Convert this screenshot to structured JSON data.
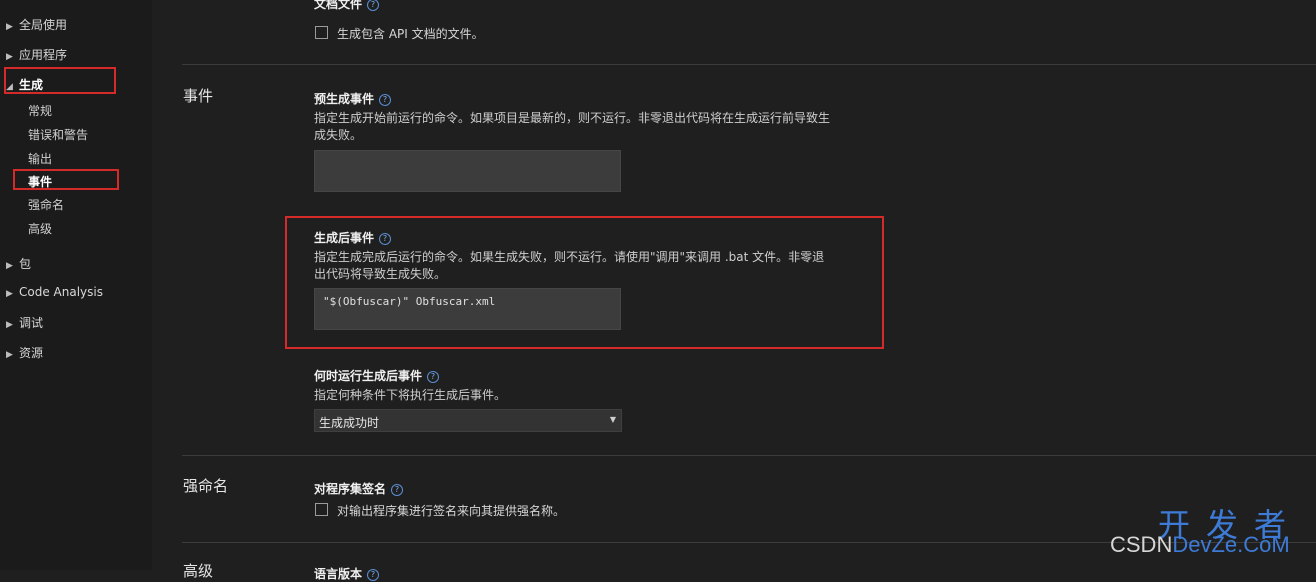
{
  "sidebar": {
    "items": [
      {
        "label": "全局使用",
        "arrow": "▶"
      },
      {
        "label": "应用程序",
        "arrow": "▶"
      },
      {
        "label": "生成",
        "arrow": "◢",
        "expanded": true
      },
      {
        "label": "包",
        "arrow": "▶"
      },
      {
        "label": "Code Analysis",
        "arrow": "▶"
      },
      {
        "label": "调试",
        "arrow": "▶"
      },
      {
        "label": "资源",
        "arrow": "▶"
      }
    ],
    "build_subitems": [
      {
        "label": "常规"
      },
      {
        "label": "错误和警告"
      },
      {
        "label": "输出"
      },
      {
        "label": "事件",
        "selected": true
      },
      {
        "label": "强命名"
      },
      {
        "label": "高级"
      }
    ]
  },
  "main": {
    "top_partial_label": "文档文件",
    "doc_checkbox_label": "生成包含 API 文档的文件。",
    "events_section": {
      "title": "事件",
      "pre_build": {
        "title": "预生成事件",
        "desc": "指定生成开始前运行的命令。如果项目是最新的，则不运行。非零退出代码将在生成运行前导致生成失败。",
        "value": ""
      },
      "post_build": {
        "title": "生成后事件",
        "desc": "指定生成完成后运行的命令。如果生成失败，则不运行。请使用\"调用\"来调用 .bat 文件。非零退出代码将导致生成失败。",
        "value": "\"$(Obfuscar)\" Obfuscar.xml"
      },
      "run_when": {
        "title": "何时运行生成后事件",
        "desc": "指定何种条件下将执行生成后事件。",
        "selected": "生成成功时"
      }
    },
    "strong_name_section": {
      "title": "强命名",
      "field_title": "对程序集签名",
      "checkbox_label": "对输出程序集进行签名来向其提供强名称。"
    },
    "advanced_section": {
      "title": "高级",
      "partial_field": "语言版本"
    }
  },
  "watermark": {
    "big": "开发者",
    "small_prefix": "CSDN",
    "small_suffix": "DevZe.CoM"
  },
  "help_glyph": "?",
  "colors": {
    "highlight": "#d42a2a",
    "accent": "#3e7bd6",
    "background": "#1f1f1f"
  }
}
